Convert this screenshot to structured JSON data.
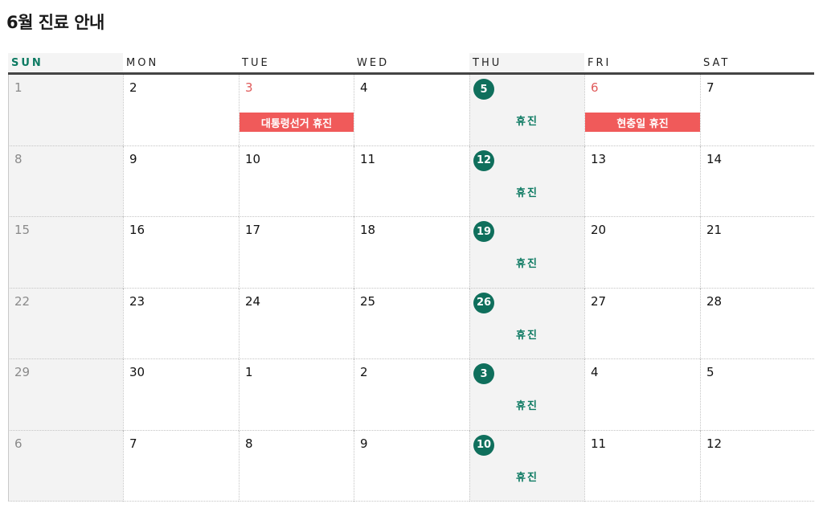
{
  "title": "6월 진료 안내",
  "weekdays": [
    "SUN",
    "MON",
    "TUE",
    "WED",
    "THU",
    "FRI",
    "SAT"
  ],
  "closed_label": "휴진",
  "weeks": [
    [
      {
        "day": "1"
      },
      {
        "day": "2"
      },
      {
        "day": "3",
        "holiday": "대통령선거 휴진"
      },
      {
        "day": "4"
      },
      {
        "day": "5",
        "closed": true
      },
      {
        "day": "6",
        "holiday": "현충일 휴진"
      },
      {
        "day": "7"
      }
    ],
    [
      {
        "day": "8"
      },
      {
        "day": "9"
      },
      {
        "day": "10"
      },
      {
        "day": "11"
      },
      {
        "day": "12",
        "closed": true
      },
      {
        "day": "13"
      },
      {
        "day": "14"
      }
    ],
    [
      {
        "day": "15"
      },
      {
        "day": "16"
      },
      {
        "day": "17"
      },
      {
        "day": "18"
      },
      {
        "day": "19",
        "closed": true
      },
      {
        "day": "20"
      },
      {
        "day": "21"
      }
    ],
    [
      {
        "day": "22"
      },
      {
        "day": "23"
      },
      {
        "day": "24"
      },
      {
        "day": "25"
      },
      {
        "day": "26",
        "closed": true
      },
      {
        "day": "27"
      },
      {
        "day": "28"
      }
    ],
    [
      {
        "day": "29"
      },
      {
        "day": "30"
      },
      {
        "day": "1"
      },
      {
        "day": "2"
      },
      {
        "day": "3",
        "closed": true
      },
      {
        "day": "4"
      },
      {
        "day": "5"
      }
    ],
    [
      {
        "day": "6"
      },
      {
        "day": "7"
      },
      {
        "day": "8"
      },
      {
        "day": "9"
      },
      {
        "day": "10",
        "closed": true
      },
      {
        "day": "11"
      },
      {
        "day": "12"
      }
    ]
  ],
  "colors": {
    "accent_green": "#0f6f5c",
    "holiday_red": "#f05a5a",
    "weekend_bg": "#f3f3f3"
  }
}
